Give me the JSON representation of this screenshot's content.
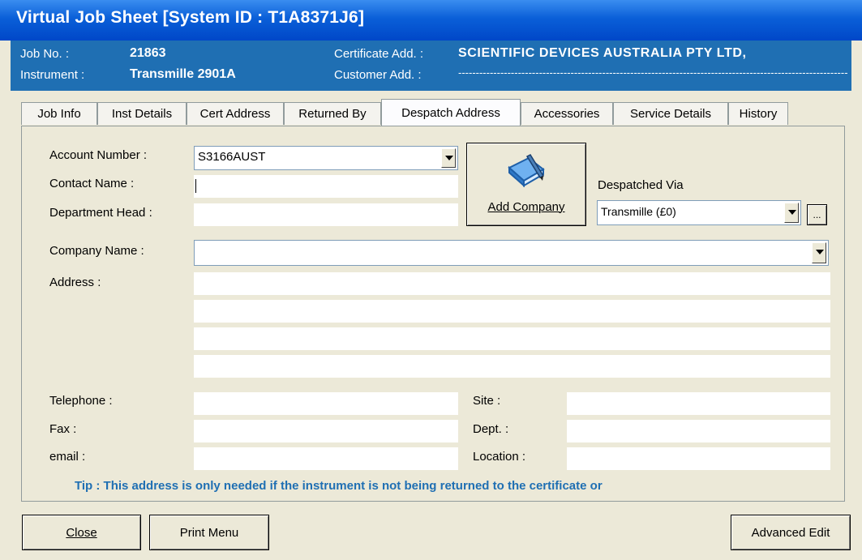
{
  "window": {
    "title": "Virtual Job Sheet [System ID : T1A8371J6]"
  },
  "header": {
    "job_no_label": "Job No. :",
    "job_no_value": "21863",
    "instrument_label": "Instrument :",
    "instrument_value": "Transmille 2901A",
    "cert_add_label": "Certificate Add. :",
    "cert_add_value": "SCIENTIFIC DEVICES AUSTRALIA PTY LTD,",
    "cust_add_label": "Customer Add. :",
    "cust_add_value": "-------------------------------------------------------------------------------------------------------------------"
  },
  "tabs": [
    {
      "label": "Job Info"
    },
    {
      "label": "Inst Details"
    },
    {
      "label": "Cert Address"
    },
    {
      "label": "Returned By"
    },
    {
      "label": "Despatch Address"
    },
    {
      "label": "Accessories"
    },
    {
      "label": "Service Details"
    },
    {
      "label": "History"
    }
  ],
  "form": {
    "account_number_label": "Account Number :",
    "account_number_value": "S3166AUST",
    "contact_name_label": "Contact Name :",
    "contact_name_value": "",
    "department_head_label": "Department Head :",
    "department_head_value": "",
    "add_company_label": "Add Company",
    "despatched_via_label": "Despatched Via",
    "despatched_via_value": "Transmille (£0)",
    "more_button_label": "...",
    "company_name_label": "Company Name :",
    "company_name_value": "",
    "address_label": "Address :",
    "telephone_label": "Telephone :",
    "fax_label": "Fax :",
    "email_label": "email :",
    "site_label": "Site :",
    "dept_label": "Dept. :",
    "location_label": "Location :",
    "tip": "Tip : This address is only needed if the instrument is not being returned to the certificate or"
  },
  "footer": {
    "close_label": "Close",
    "print_menu_label": "Print Menu",
    "advanced_edit_label": "Advanced Edit"
  },
  "colors": {
    "titlebar": "#0a5fd8",
    "infobar": "#1f6fb3",
    "tip": "#1f6fb3"
  },
  "icons": {
    "add_company": "book-pen-icon"
  }
}
